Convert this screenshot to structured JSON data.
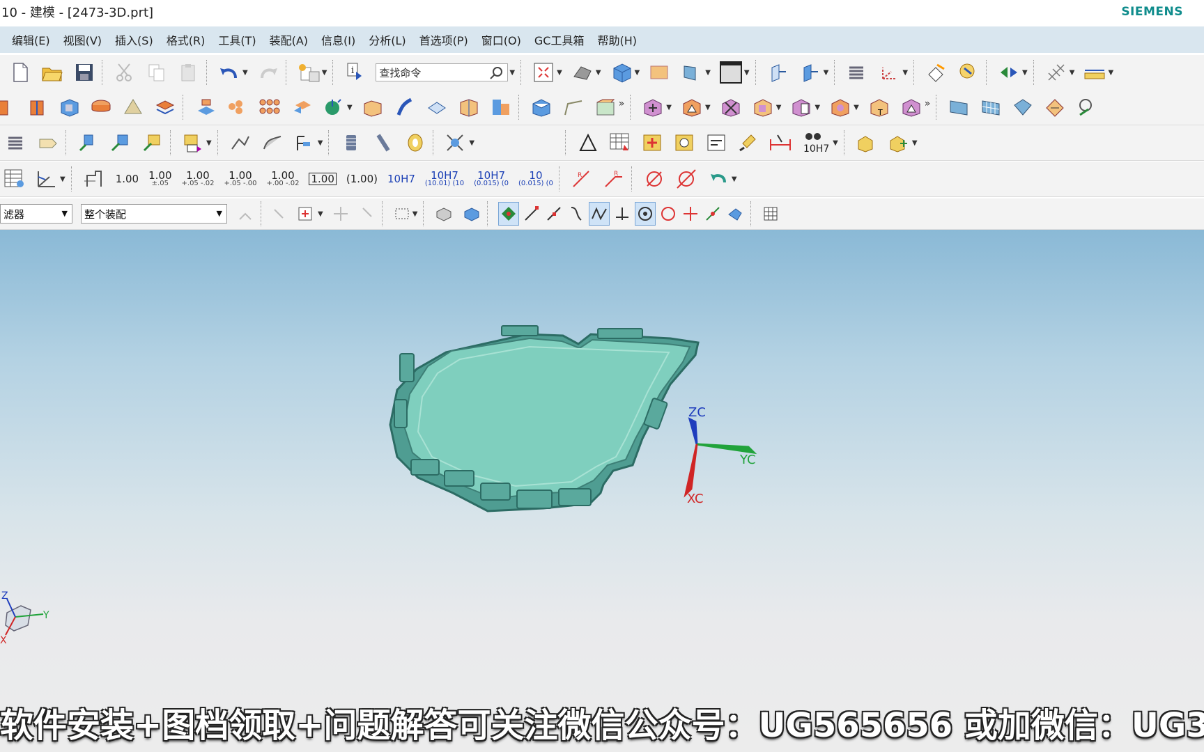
{
  "window": {
    "title": "10 - 建模 - [2473-3D.prt]",
    "brand": "SIEMENS"
  },
  "menu": [
    "编辑(E)",
    "视图(V)",
    "插入(S)",
    "格式(R)",
    "工具(T)",
    "装配(A)",
    "信息(I)",
    "分析(L)",
    "首选项(P)",
    "窗口(O)",
    "GC工具箱",
    "帮助(H)"
  ],
  "search": {
    "placeholder": "查找命令"
  },
  "dimensions": {
    "d1": "1.00",
    "d2": "1.00",
    "d2s": "±.05",
    "d3": "1.00",
    "d3s": "+.05 -.02",
    "d4": "1.00",
    "d4s": "+.05 -.00",
    "d5": "1.00",
    "d5s": "+.00 -.02",
    "d6": "1.00",
    "d7": "(1.00)",
    "d8": "10H7",
    "d9": "10H7",
    "d9s": "(10.01) (10",
    "d10": "10H7",
    "d10s": "(0.015) (0",
    "d11": "10",
    "d11s": "(0.015) (0"
  },
  "toolbar3_label": "10H7",
  "filters": {
    "type_filter": "滤器",
    "scope": "整个装配"
  },
  "axes": {
    "zc": "ZC",
    "yc": "YC",
    "xc": "XC",
    "mini_z": "Z",
    "mini_y": "Y",
    "mini_x": "X"
  },
  "caption": "软件安装+图档领取+问题解答可关注微信公众号：UG565656 或加微信：UG3",
  "colors": {
    "menubar": "#d9e6ef",
    "part": "#7fcfbe",
    "viewport_top": "#8ab9d6",
    "viewport_bottom": "#ececec",
    "brand": "#0f8c8c"
  }
}
